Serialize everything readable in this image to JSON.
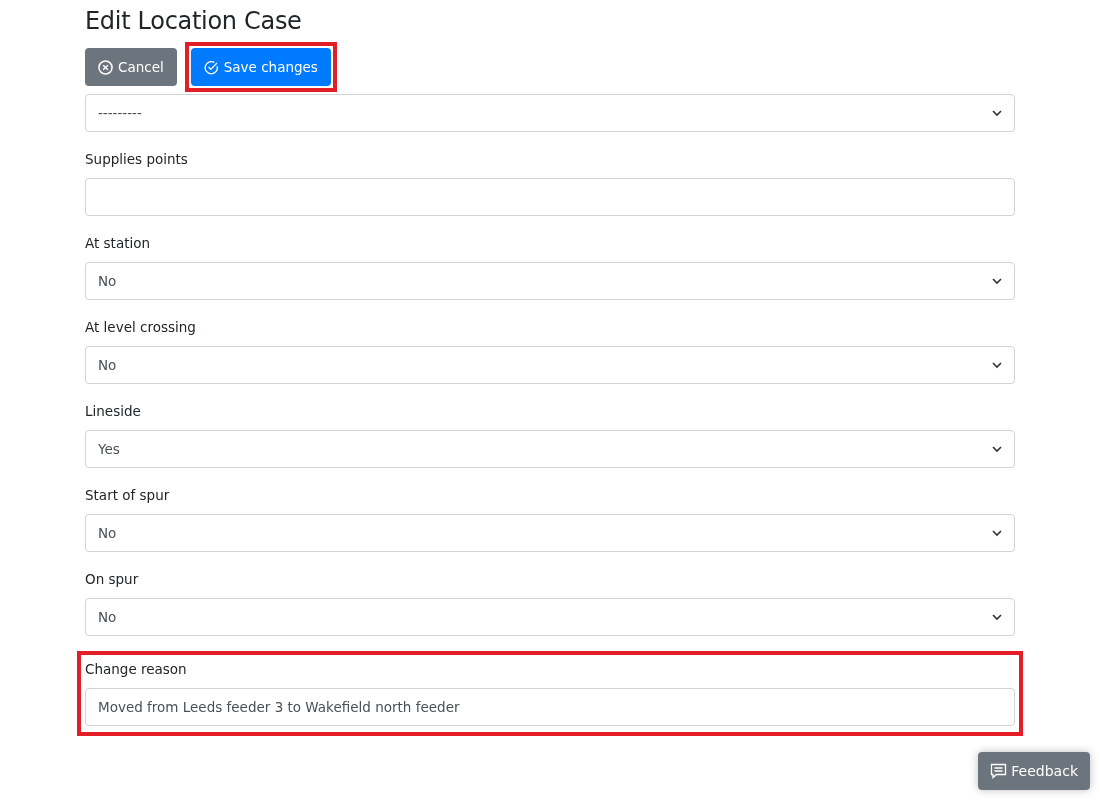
{
  "title": "Edit Location Case",
  "buttons": [
    {
      "label": "Cancel",
      "kind": "cancel",
      "highlighted": false
    },
    {
      "label": "Save changes",
      "kind": "save",
      "highlighted": true
    }
  ],
  "fields": [
    {
      "kind": "select",
      "value": "---------",
      "highlighted": false
    },
    {
      "kind": "text",
      "label": "Supplies points",
      "highlighted": false
    },
    {
      "kind": "select",
      "label": "At station",
      "value": "No",
      "highlighted": false
    },
    {
      "kind": "select",
      "label": "At level crossing",
      "value": "No",
      "highlighted": false
    },
    {
      "kind": "select",
      "label": "Lineside",
      "value": "Yes",
      "highlighted": false
    },
    {
      "kind": "select",
      "label": "Start of spur",
      "value": "No",
      "highlighted": false
    },
    {
      "kind": "select",
      "label": "On spur",
      "value": "No",
      "highlighted": false
    },
    {
      "kind": "text",
      "label": "Change reason",
      "value": "Moved from Leeds feeder 3 to Wakefield north feeder",
      "highlighted": true
    }
  ],
  "feedback_button": {
    "label": "Feedback"
  }
}
